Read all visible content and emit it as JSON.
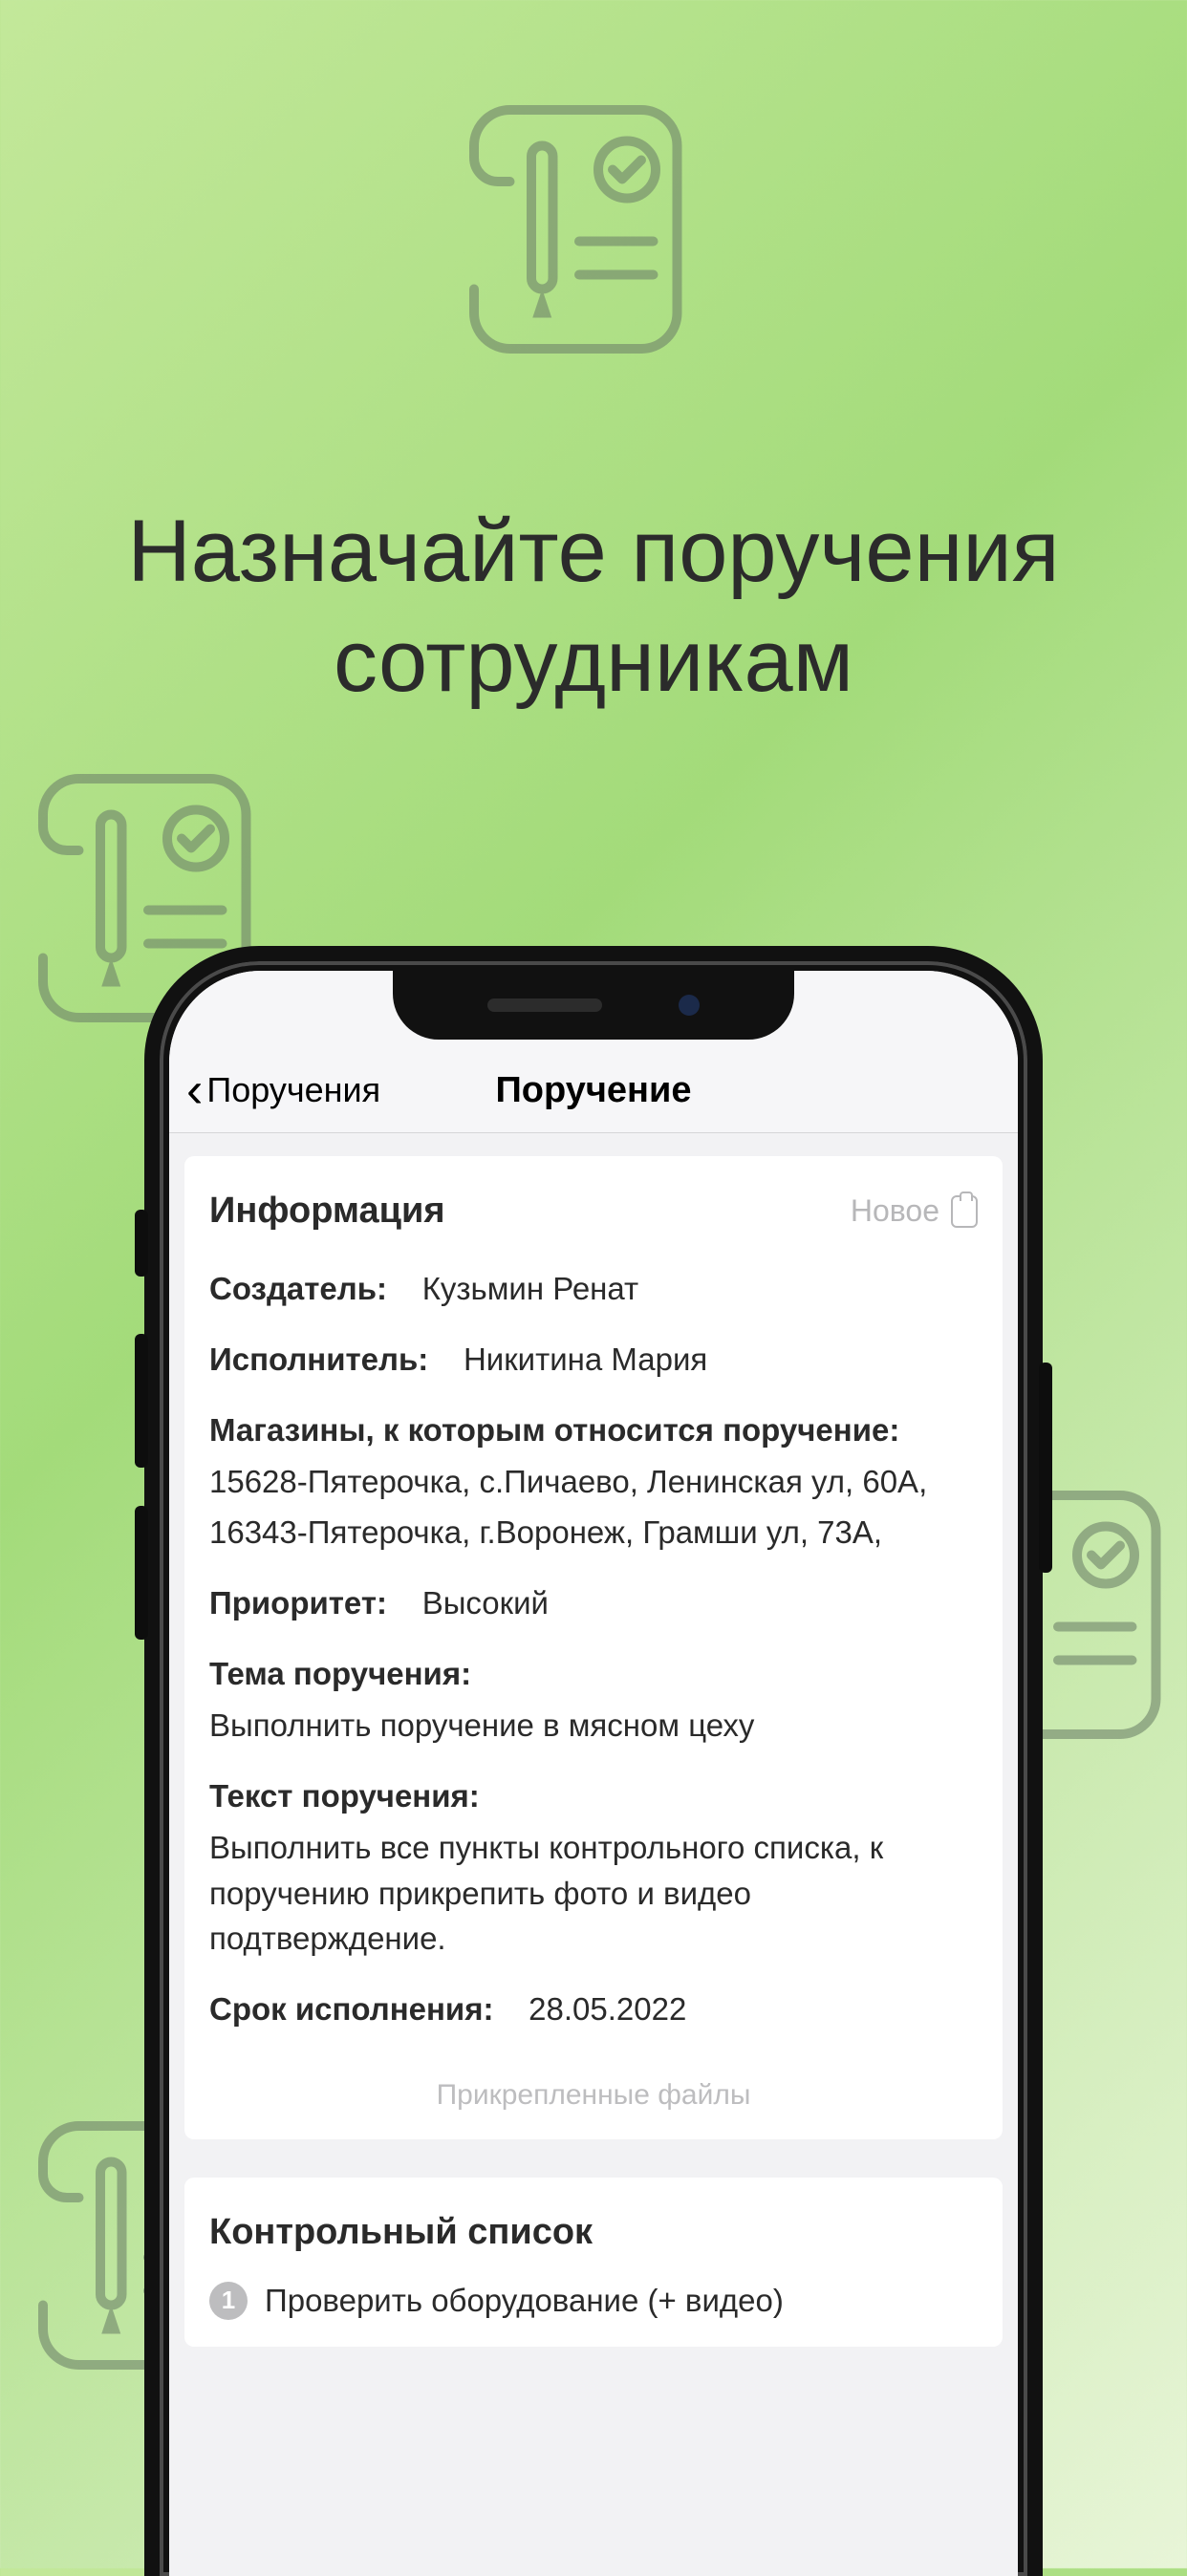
{
  "promo": {
    "headline_line1": "Назначайте поручения",
    "headline_line2": "сотрудникам"
  },
  "nav": {
    "back_label": "Поручения",
    "title": "Поручение"
  },
  "info_card": {
    "title": "Информация",
    "status_label": "Новое",
    "creator_label": "Создатель:",
    "creator_value": "Кузьмин Ренат",
    "assignee_label": "Исполнитель:",
    "assignee_value": "Никитина Мария",
    "stores_label": "Магазины, к которым относится поручение:",
    "stores_line1": "15628-Пятерочка, с.Пичаево, Ленинская ул, 60А,",
    "stores_line2": "16343-Пятерочка, г.Воронеж, Грамши ул, 73А,",
    "priority_label": "Приоритет:",
    "priority_value": "Высокий",
    "subject_label": "Тема поручения:",
    "subject_value": "Выполнить поручение в мясном цеху",
    "body_label": "Текст поручения:",
    "body_value": "Выполнить все пункты контрольного списка, к поручению прикрепить фото и видео подтверждение.",
    "deadline_label": "Срок исполнения:",
    "deadline_value": "28.05.2022",
    "attachments_label": "Прикрепленные файлы"
  },
  "checklist": {
    "title": "Контрольный список",
    "item1_num": "1",
    "item1_text": "Проверить оборудование (+ видео)"
  }
}
